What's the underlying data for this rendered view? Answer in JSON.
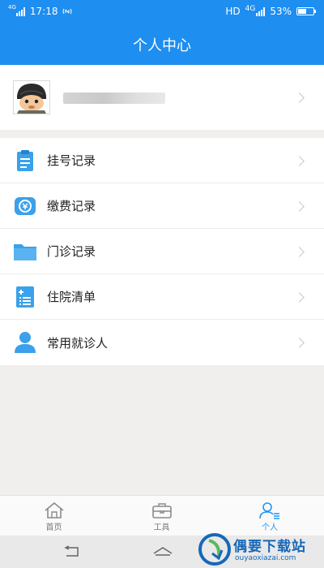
{
  "status_bar": {
    "network_left": "4G",
    "time": "17:18",
    "hd": "HD",
    "network_right": "4G",
    "battery_percent_text": "53%",
    "battery_level": 0.53
  },
  "header": {
    "title": "个人中心"
  },
  "profile": {
    "name_obscured": true
  },
  "menu": {
    "items": [
      {
        "label": "挂号记录",
        "icon": "clipboard-icon",
        "color": "#3aa1ea"
      },
      {
        "label": "缴费记录",
        "icon": "wallet-icon",
        "color": "#3aa1ea"
      },
      {
        "label": "门诊记录",
        "icon": "folder-icon",
        "color": "#3aa1ea"
      },
      {
        "label": "住院清单",
        "icon": "list-icon",
        "color": "#3aa1ea"
      },
      {
        "label": "常用就诊人",
        "icon": "person-icon",
        "color": "#3aa1ea"
      }
    ]
  },
  "tabs": [
    {
      "label": "首页",
      "icon": "home-icon",
      "active": false
    },
    {
      "label": "工具",
      "icon": "toolbox-icon",
      "active": false
    },
    {
      "label": "个人",
      "icon": "user-icon",
      "active": true
    }
  ],
  "watermark": {
    "title": "偶要下载站",
    "subtitle": "ouyaoxiazai.com"
  },
  "colors": {
    "primary": "#1e8ef0",
    "accent_tab": "#2196f3",
    "background": "#f1efee"
  }
}
